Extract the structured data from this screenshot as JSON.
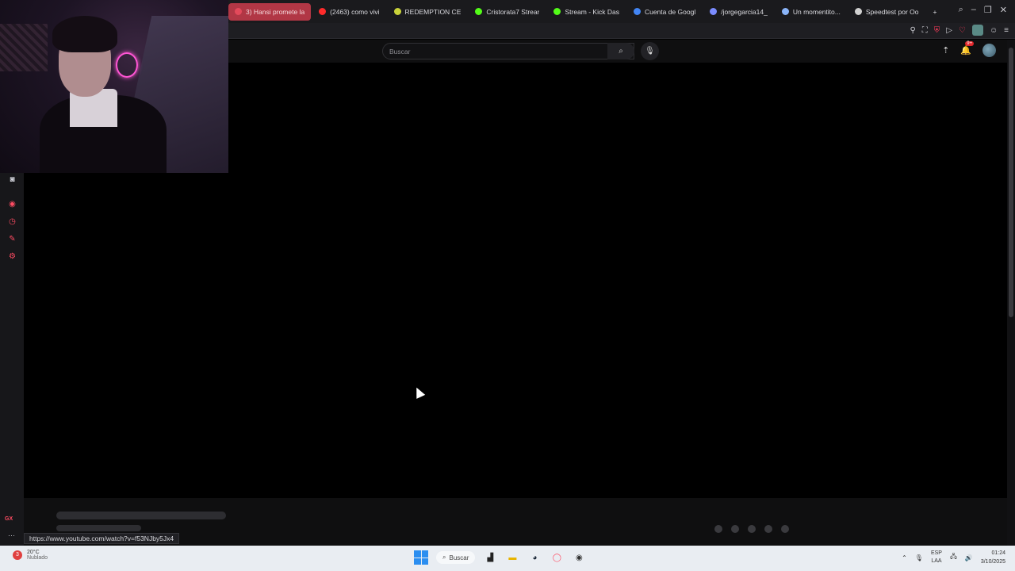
{
  "browser": {
    "tabs": [
      {
        "label": "3) Hansi promete la",
        "icon_color": "#e34a5b",
        "active": true
      },
      {
        "label": "(2463) como vivi",
        "icon_color": "#ff2b2b",
        "active": false
      },
      {
        "label": "REDEMPTION CE",
        "icon_color": "#c9d23a",
        "active": false
      },
      {
        "label": "Cristorata7 Strear",
        "icon_color": "#53fc18",
        "active": false
      },
      {
        "label": "Stream - Kick Das",
        "icon_color": "#53fc18",
        "active": false
      },
      {
        "label": "Cuenta de Googl",
        "icon_color": "#4285f4",
        "active": false
      },
      {
        "label": "/jorgegarcia14_",
        "icon_color": "#7b8cff",
        "active": false
      },
      {
        "label": "Un momentito...",
        "icon_color": "#8ab4f8",
        "active": false
      },
      {
        "label": "Speedtest por Oo",
        "icon_color": "#d0d0d0",
        "active": false
      }
    ],
    "new_tab_symbol": "+",
    "status_url": "https://www.youtube.com/watch?v=f53NJby5Jx4"
  },
  "youtube": {
    "search_placeholder": "Buscar",
    "notification_badge": "9+"
  },
  "sidebar": {
    "gx_label": "GX",
    "more_label": "···"
  },
  "taskbar": {
    "weather_badge": "3",
    "weather_temp": "20°C",
    "weather_condition": "Nublado",
    "search_label": "Buscar",
    "language_line1": "ESP",
    "language_line2": "LAA",
    "time": "01:24",
    "date": "3/10/2025"
  },
  "placeholder_dots": 5,
  "colors": {
    "accent": "#ff4c63",
    "active_tab": "#b13745",
    "taskbar_bg": "#e9edf2"
  }
}
